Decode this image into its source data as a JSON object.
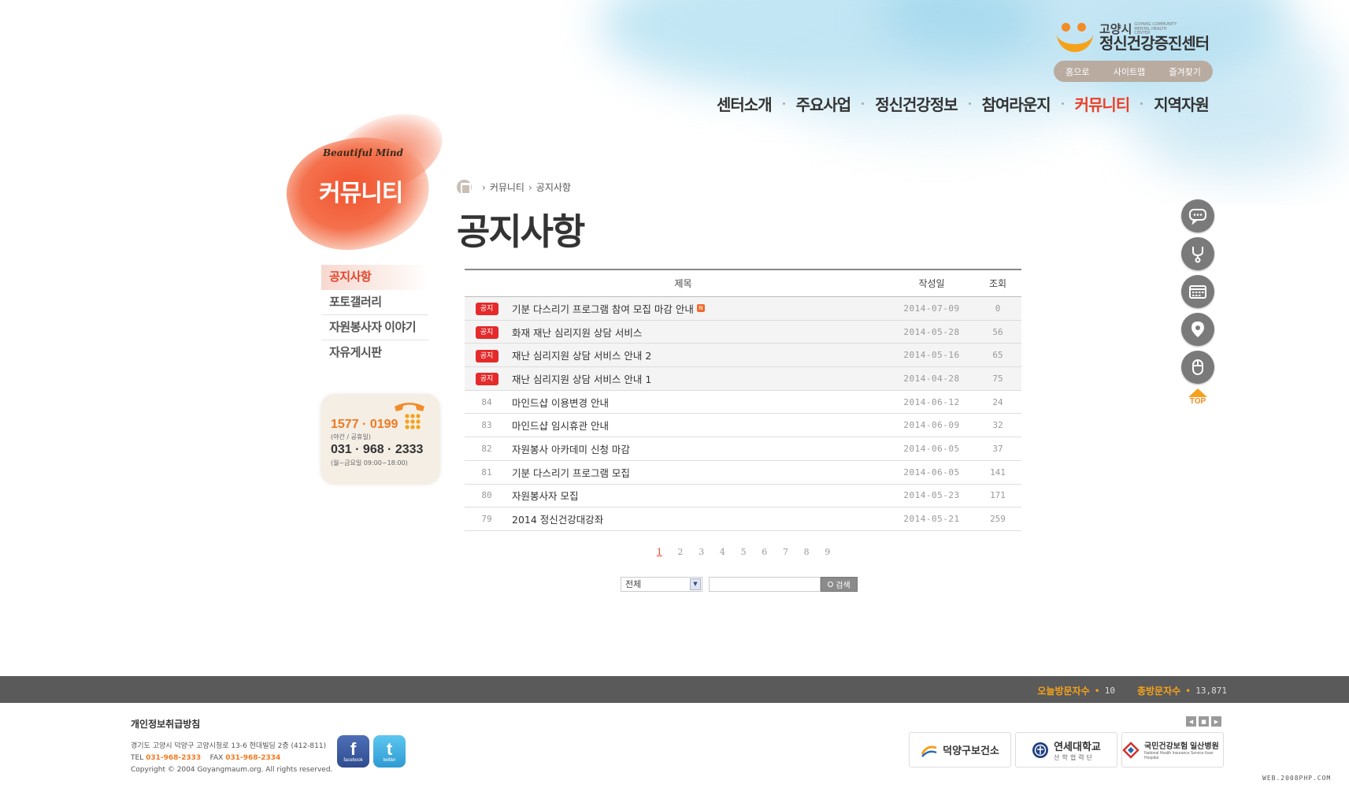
{
  "header": {
    "logo_city": "고양시",
    "logo_en": "GOYANG COMMUNITY MENTAL HEALTH CENTER",
    "logo_name": "정신건강증진센터",
    "util_links": [
      "홈으로",
      "사이트맵",
      "즐겨찾기"
    ],
    "gnb": [
      "센터소개",
      "주요사업",
      "정신건강정보",
      "참여라운지",
      "커뮤니티",
      "지역자원"
    ],
    "gnb_active": "커뮤니티"
  },
  "section": {
    "tagline": "Beautiful Mind",
    "title": "커뮤니티"
  },
  "lnb": {
    "items": [
      "공지사항",
      "포토갤러리",
      "자원봉사자 이야기",
      "자유게시판"
    ],
    "active": "공지사항"
  },
  "phone": {
    "hotline": "1577 · 0199",
    "hotline_note": "(야간 / 공휴일)",
    "office": "031 · 968 · 2333",
    "office_note": "(월~금요일 09:00~18:00)"
  },
  "breadcrumb": [
    "커뮤니티",
    "공지사항"
  ],
  "page_title": "공지사항",
  "board": {
    "columns": {
      "title": "제목",
      "date": "작성일",
      "hits": "조회"
    },
    "notice_label": "공지",
    "new_label": "N",
    "notices": [
      {
        "title": "기분 다스리기 프로그램 참여 모집 마감 안내",
        "date": "2014-07-09",
        "hits": "0",
        "new": true
      },
      {
        "title": "화재 재난 심리지원 상담 서비스",
        "date": "2014-05-28",
        "hits": "56",
        "new": false
      },
      {
        "title": "재난 심리지원 상담 서비스 안내 2",
        "date": "2014-05-16",
        "hits": "65",
        "new": false
      },
      {
        "title": "재난 심리지원 상담 서비스 안내 1",
        "date": "2014-04-28",
        "hits": "75",
        "new": false
      }
    ],
    "posts": [
      {
        "no": "84",
        "title": "마인드샵 이용변경 안내",
        "date": "2014-06-12",
        "hits": "24"
      },
      {
        "no": "83",
        "title": "마인드샵 임시휴관 안내",
        "date": "2014-06-09",
        "hits": "32"
      },
      {
        "no": "82",
        "title": "자원봉사 아카데미 신청 마감",
        "date": "2014-06-05",
        "hits": "37"
      },
      {
        "no": "81",
        "title": "기분 다스리기 프로그램 모집",
        "date": "2014-06-05",
        "hits": "141"
      },
      {
        "no": "80",
        "title": "자원봉사자 모집",
        "date": "2014-05-23",
        "hits": "171"
      },
      {
        "no": "79",
        "title": "2014 정신건강대강좌",
        "date": "2014-05-21",
        "hits": "259"
      }
    ]
  },
  "pagination": {
    "pages": [
      "1",
      "2",
      "3",
      "4",
      "5",
      "6",
      "7",
      "8",
      "9"
    ],
    "current": "1"
  },
  "search": {
    "select_value": "전체",
    "button": "검색",
    "input_value": ""
  },
  "quick_menu": {
    "icons": [
      "chat-icon",
      "stethoscope-icon",
      "calendar-icon",
      "location-icon",
      "mouse-icon"
    ],
    "top_label": "TOP"
  },
  "stats": {
    "today_label": "오늘방문자수",
    "today_value": "10",
    "total_label": "총방문자수",
    "total_value": "13,871"
  },
  "footer": {
    "privacy": "개인정보취급방침",
    "address": "경기도 고양시 덕양구 고양시청로 13-6 현대빌딩 2층 (412-811)",
    "tel_label": "TEL",
    "tel": "031-968-2333",
    "fax_label": "FAX",
    "fax": "031-968-2334",
    "copyright": "Copyright © 2004 Goyangmaum.org. All rights reserved.",
    "sns": [
      {
        "icon": "f",
        "label": "facebook"
      },
      {
        "icon": "t",
        "label": "twitter"
      }
    ],
    "family": [
      {
        "name": "덕양구보건소",
        "sub": ""
      },
      {
        "name": "연세대학교",
        "sub": "산학협력단"
      },
      {
        "name": "국민건강보험 일산병원",
        "sub": "National Health Insurance Service Ilsan Hospital"
      }
    ]
  },
  "watermark": "WEB.2008PHP.COM",
  "colors": {
    "accent": "#ec3e26",
    "orange": "#f5a21a",
    "bar": "#5a5a5a"
  }
}
